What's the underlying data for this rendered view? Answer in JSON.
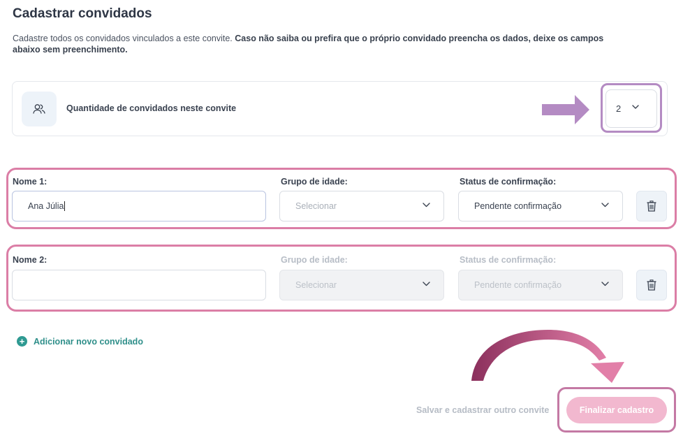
{
  "page": {
    "title": "Cadastrar convidados",
    "description": "Cadastre todos os convidados vinculados a este convite.",
    "description_bold": "Caso não saiba ou prefira que o próprio convidado preencha os dados, deixe os campos abaixo sem preenchimento."
  },
  "quantity": {
    "icon": "users-icon",
    "label": "Quantidade de convidados neste convite",
    "value": "2"
  },
  "guests": [
    {
      "name_label": "Nome 1:",
      "name_value": "Ana Júlia",
      "age_label": "Grupo de idade:",
      "age_placeholder": "Selecionar",
      "status_label": "Status de confirmação:",
      "status_value": "Pendente confirmação",
      "enabled": true
    },
    {
      "name_label": "Nome 2:",
      "name_value": "",
      "age_label": "Grupo de idade:",
      "age_placeholder": "Selecionar",
      "status_label": "Status de confirmação:",
      "status_value": "Pendente confirmação",
      "enabled": false
    }
  ],
  "actions": {
    "add_guest": "Adicionar novo convidado",
    "save_other": "Salvar e cadastrar outro convite",
    "finish": "Finalizar cadastro"
  },
  "colors": {
    "highlight_pink": "#db7ea6",
    "highlight_purple": "#b48bc3",
    "teal": "#2f8f8a",
    "finish_button": "#f2b8cf"
  }
}
